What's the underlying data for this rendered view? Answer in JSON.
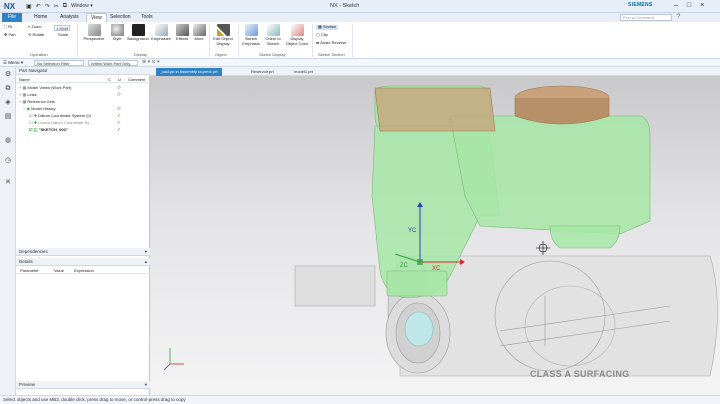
{
  "app": {
    "logo": "NX",
    "window_title": "NX - Sketch",
    "brand": "SIEMENS",
    "window_menu": "Window"
  },
  "tabs": [
    "File",
    "Home",
    "Analysis",
    "View",
    "Selection",
    "Tools"
  ],
  "active_tab": "View",
  "find_command": {
    "placeholder": "Find a Command"
  },
  "ribbon": {
    "fit": "Fit",
    "zoom": "Zoom",
    "pan": "Pan",
    "rotate": "Rotate",
    "scale_value": "1.5949",
    "scale_label": "Scale",
    "operation_label": "Operation",
    "perspective": "Perspective",
    "style": "Style",
    "background": "Background",
    "emphasize": "Emphasize",
    "effects": "Effects",
    "more": "More",
    "display_label": "Display",
    "edit_object_display": "Edit Object Display",
    "object_label": "Object",
    "sketch_emphasis": "Sketch Emphasis",
    "orient_to_sketch": "Orient to Sketch",
    "display_object_color": "Display Object Color",
    "sketch_display_label": "Sketch Display",
    "section": "Section",
    "clip": "Clip",
    "audio_reverse": "Audio Reverse",
    "sketch_section_label": "Sketch Section"
  },
  "selection_bar": {
    "menu": "Menu",
    "filter": "No Selection Filter",
    "scope": "Within Work Part Only"
  },
  "navigator": {
    "title": "Part Navigator",
    "columns": {
      "name": "Name",
      "c": "C",
      "u": "U",
      "comment": "Comment"
    },
    "rows": [
      {
        "label": "Model Views (Work Part)",
        "indent": 0
      },
      {
        "label": "Links",
        "indent": 0
      },
      {
        "label": "Reference Sets",
        "indent": 0
      },
      {
        "label": "Model History",
        "indent": 1
      },
      {
        "label": "Datum Coordinate System (0)",
        "indent": 2
      },
      {
        "label": "Linked Datum Coordinate Sy...",
        "indent": 2
      },
      {
        "label": "\"SKETCH_000\"",
        "indent": 2
      }
    ],
    "dependencies": "Dependencies",
    "details": "Details",
    "details_columns": [
      "Parameter",
      "Value",
      "Expression"
    ],
    "preview": "Preview"
  },
  "doc_tabs": [
    "_cad.prt in Assembly ra.prm1.prt",
    "Reservoir.prt",
    "model1.prt"
  ],
  "active_doc_tab": 0,
  "triad": {
    "x": "XC",
    "y": "YC",
    "z": "ZC"
  },
  "status": "Select objects and use MB3, double click, press drag to move, or control-press drag to copy",
  "watermark": "CLASS A SURFACING",
  "colors": {
    "accent": "#2f82c6",
    "model_green": "#9fe3a0",
    "model_brown": "#c8a07a",
    "triad_red": "#d22b2b",
    "triad_blue": "#2a3fbf",
    "triad_green": "#2aa23c"
  }
}
